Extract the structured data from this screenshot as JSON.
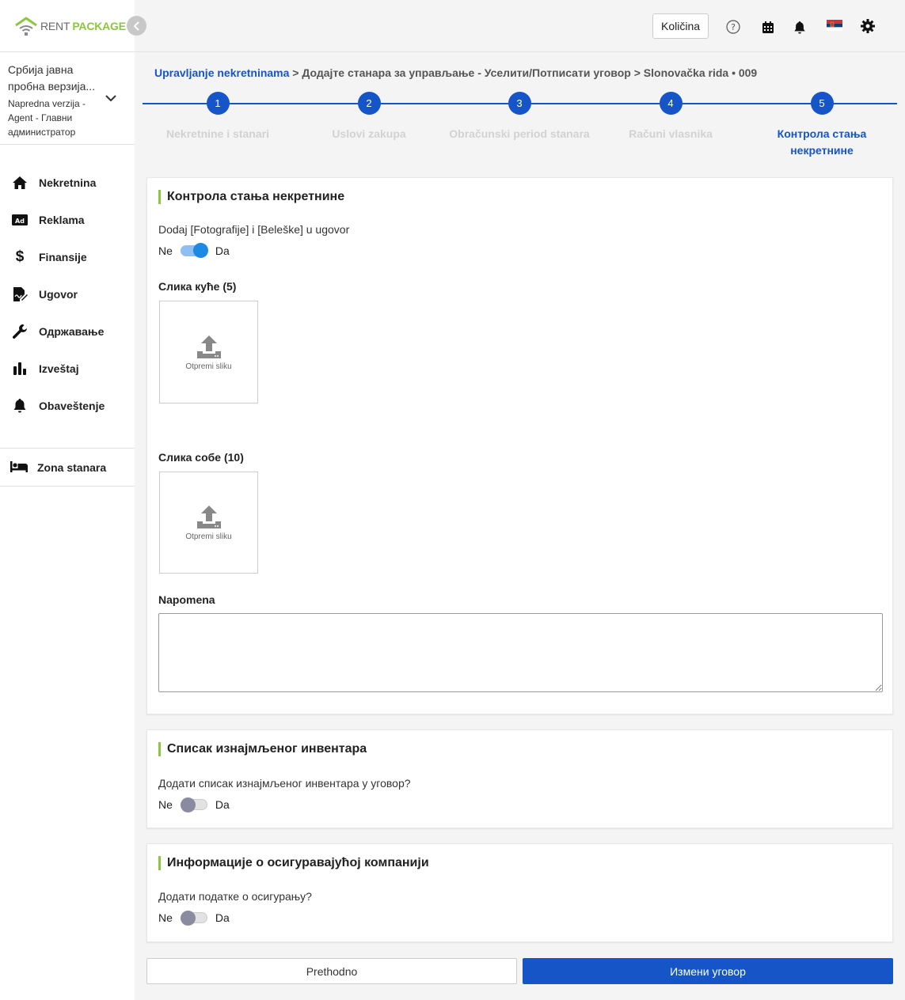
{
  "brand": {
    "rent": "RENT",
    "package": "PACKAGE",
    "accent": "#8dc63f",
    "primary": "#1555c8"
  },
  "account": {
    "name": "Србија јавна пробна верзија...",
    "role": "Napredna verzija - Agent - Главни администратор"
  },
  "sidebar": {
    "items": [
      {
        "label": "Nekretnina",
        "icon": "home-icon"
      },
      {
        "label": "Reklama",
        "icon": "ad-icon"
      },
      {
        "label": "Finansije",
        "icon": "dollar-icon"
      },
      {
        "label": "Ugovor",
        "icon": "contract-icon"
      },
      {
        "label": "Одржавање",
        "icon": "wrench-icon"
      },
      {
        "label": "Izveštaj",
        "icon": "bar-chart-icon"
      },
      {
        "label": "Obaveštenje",
        "icon": "bell-icon"
      }
    ],
    "zona": "Zona stanara"
  },
  "header": {
    "kolicina": "Količina"
  },
  "breadcrumb": {
    "root": "Upravljanje nekretninama",
    "sep": ">",
    "middle": "Додајте станара за управљање - Уселити/Потписати уговор",
    "property": "Slonovačka rida • 009"
  },
  "steps": [
    {
      "num": "1",
      "label": "Nekretnine i stanari"
    },
    {
      "num": "2",
      "label": "Uslovi zakupa"
    },
    {
      "num": "3",
      "label": "Obračunski period stanara"
    },
    {
      "num": "4",
      "label": "Računi vlasnika"
    },
    {
      "num": "5",
      "label": "Контрола стања некретнине"
    }
  ],
  "card1": {
    "title": "Контрола стања некретнине",
    "question": "Dodaj [Fotografije] i [Beleške] u ugovor",
    "no": "Ne",
    "yes": "Da",
    "house_label": "Слика куће (5)",
    "room_label": "Слика собе (10)",
    "upload_text": "Otpremi sliku",
    "note_label": "Napomena"
  },
  "card2": {
    "title": "Списак изнајмљеног инвентара",
    "question": "Додати списак изнајмљеног инвентара у уговор?",
    "no": "Ne",
    "yes": "Da"
  },
  "card3": {
    "title": "Информације о осигуравајућој компанији",
    "question": "Додати податке о осигурању?",
    "no": "Ne",
    "yes": "Da"
  },
  "buttons": {
    "prev": "Prethodno",
    "next": "Измени уговор"
  }
}
